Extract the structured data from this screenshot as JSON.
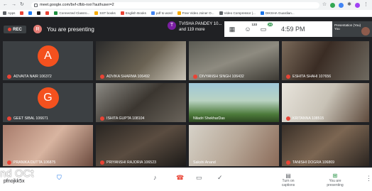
{
  "browser": {
    "url": "meet.google.com/bvf-cfbb-nxn?authuser=2",
    "bookmarks": [
      "Apps",
      "Connected Classro...",
      "SST books",
      "English Books",
      "pdf to word",
      "Free Video Joiner O...",
      "Video Compressor |...",
      "DIKSHA Guardian..."
    ]
  },
  "meet": {
    "rec_label": "REC",
    "presenter_initial": "R",
    "presenting_text": "You are presenting",
    "speaker_initial": "T",
    "speaker_line1": "TVISHA PANDEY 10...",
    "speaker_line2": "and 119 more",
    "people_count": "133",
    "chat_count": "20",
    "time": "4:59 PM",
    "preview_label": "Presentation (You)",
    "preview_short": "You"
  },
  "tiles": [
    {
      "name": "ADVAITA NAIR 106372",
      "initial": "A"
    },
    {
      "name": "ADVIKA SHARMA 106492",
      "initial": ""
    },
    {
      "name": "DIVYANSH SINGH 106432",
      "initial": ""
    },
    {
      "name": "ESHITA SHAHI 107656",
      "initial": ""
    },
    {
      "name": "GEET SIBAL 106671",
      "initial": "G"
    },
    {
      "name": "ISHITA GUPTA 108104",
      "initial": ""
    },
    {
      "name": "Niladri ShekharDas",
      "initial": ""
    },
    {
      "name": "KRITANNA 108515",
      "initial": ""
    },
    {
      "name": "PRANIKA DUTTA 106875",
      "initial": ""
    },
    {
      "name": "PRIYANSHI RAJORIA 106523",
      "initial": ""
    },
    {
      "name": "Sakshi Anand",
      "initial": ""
    },
    {
      "name": "TANISHI DOGRA 106869",
      "initial": ""
    }
  ],
  "bottom": {
    "overlay": "nd OCt",
    "meeting_code": "pfnojkk5x",
    "captions": "Turn on captions",
    "presenting": "You are presenting"
  }
}
